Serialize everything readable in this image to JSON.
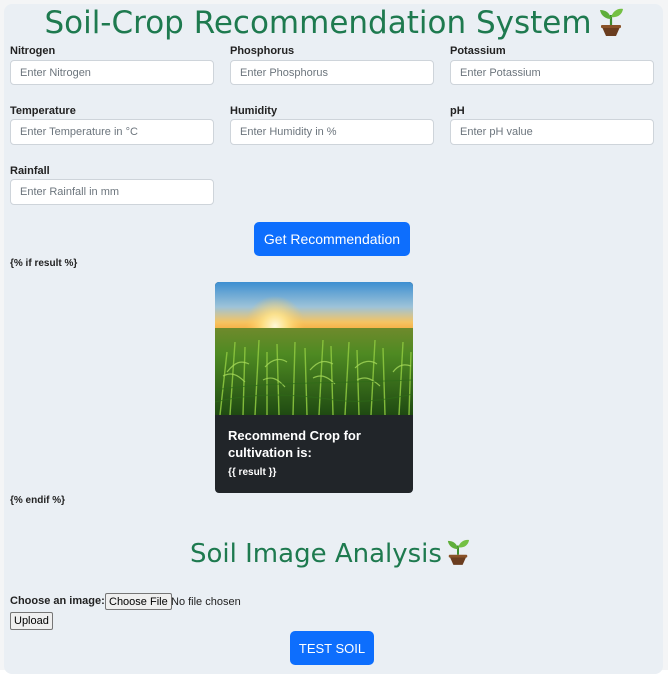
{
  "header": {
    "title": "Soil-Crop Recommendation System"
  },
  "form": {
    "fields": [
      {
        "label": "Nitrogen",
        "placeholder": "Enter Nitrogen"
      },
      {
        "label": "Phosphorus",
        "placeholder": "Enter Phosphorus"
      },
      {
        "label": "Potassium",
        "placeholder": "Enter Potassium"
      },
      {
        "label": "Temperature",
        "placeholder": "Enter Temperature in °C"
      },
      {
        "label": "Humidity",
        "placeholder": "Enter Humidity in %"
      },
      {
        "label": "pH",
        "placeholder": "Enter pH value"
      },
      {
        "label": "Rainfall",
        "placeholder": "Enter Rainfall in mm"
      }
    ],
    "submit_label": "Get Recommendation"
  },
  "template_if": "{% if result %}",
  "template_endif": "{% endif %}",
  "result_card": {
    "title": "Recommend Crop for cultivation is:",
    "result": "{{ result }}"
  },
  "soil_section": {
    "title": "Soil Image Analysis",
    "choose_label": "Choose an image:",
    "choose_button": "Choose File",
    "file_status": "No file chosen",
    "upload_label": "Upload",
    "test_label": "TEST SOIL"
  },
  "colors": {
    "heading": "#1e7a4f",
    "primary": "#0d6efd",
    "card_bg": "#212529"
  },
  "icons": {
    "title_icon": "seedling-icon",
    "subtitle_icon": "seedling-icon"
  }
}
